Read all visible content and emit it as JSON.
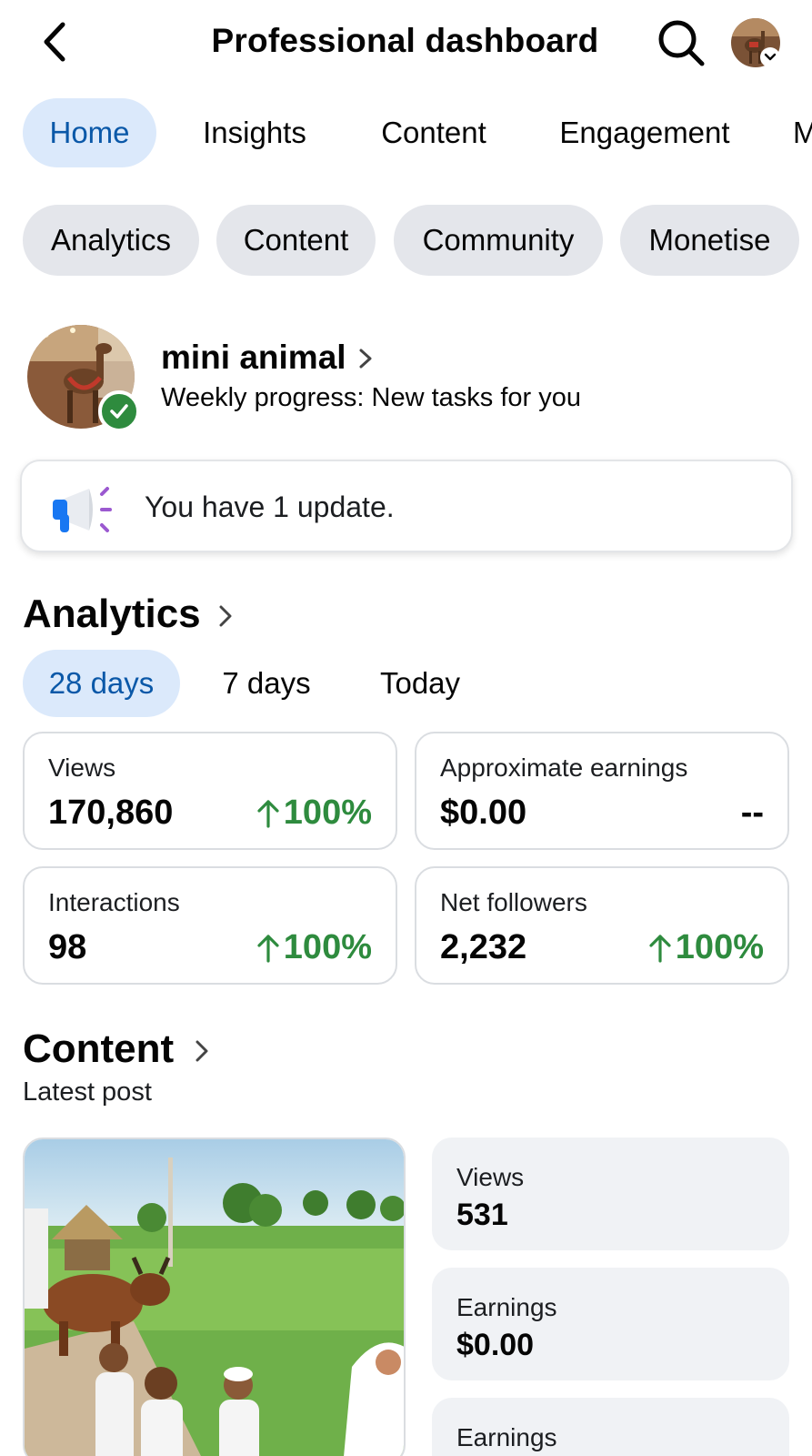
{
  "header": {
    "title": "Professional dashboard",
    "back_icon": "chevron-left-icon",
    "search_icon": "search-icon"
  },
  "tabs": [
    {
      "label": "Home",
      "active": true
    },
    {
      "label": "Insights",
      "active": false
    },
    {
      "label": "Content",
      "active": false
    },
    {
      "label": "Engagement",
      "active": false
    },
    {
      "label": "M",
      "active": false
    }
  ],
  "chips": [
    {
      "label": "Analytics"
    },
    {
      "label": "Content"
    },
    {
      "label": "Community"
    },
    {
      "label": "Monetise"
    }
  ],
  "profile": {
    "name": "mini animal",
    "subtitle": "Weekly progress: New tasks for you"
  },
  "update": {
    "text": "You have 1 update."
  },
  "analytics": {
    "title": "Analytics",
    "periods": [
      {
        "label": "28 days",
        "active": true
      },
      {
        "label": "7 days",
        "active": false
      },
      {
        "label": "Today",
        "active": false
      }
    ],
    "metrics": [
      {
        "label": "Views",
        "value": "170,860",
        "change": "100%",
        "trend": "up"
      },
      {
        "label": "Approximate earnings",
        "value": "$0.00",
        "change": "--",
        "trend": "none"
      },
      {
        "label": "Interactions",
        "value": "98",
        "change": "100%",
        "trend": "up"
      },
      {
        "label": "Net followers",
        "value": "2,232",
        "change": "100%",
        "trend": "up"
      }
    ]
  },
  "content": {
    "title": "Content",
    "subtitle": "Latest post",
    "stats": [
      {
        "label": "Views",
        "value": "531"
      },
      {
        "label": "Earnings",
        "value": "$0.00"
      },
      {
        "label": "Earnings",
        "value": ""
      }
    ]
  },
  "colors": {
    "accent_blue": "#0a58a8",
    "active_tab_bg": "#dbe9fb",
    "chip_bg": "#e4e6eb",
    "positive_green": "#2e8b3e",
    "card_border": "#dadde1",
    "stat_card_bg": "#f0f2f5"
  }
}
